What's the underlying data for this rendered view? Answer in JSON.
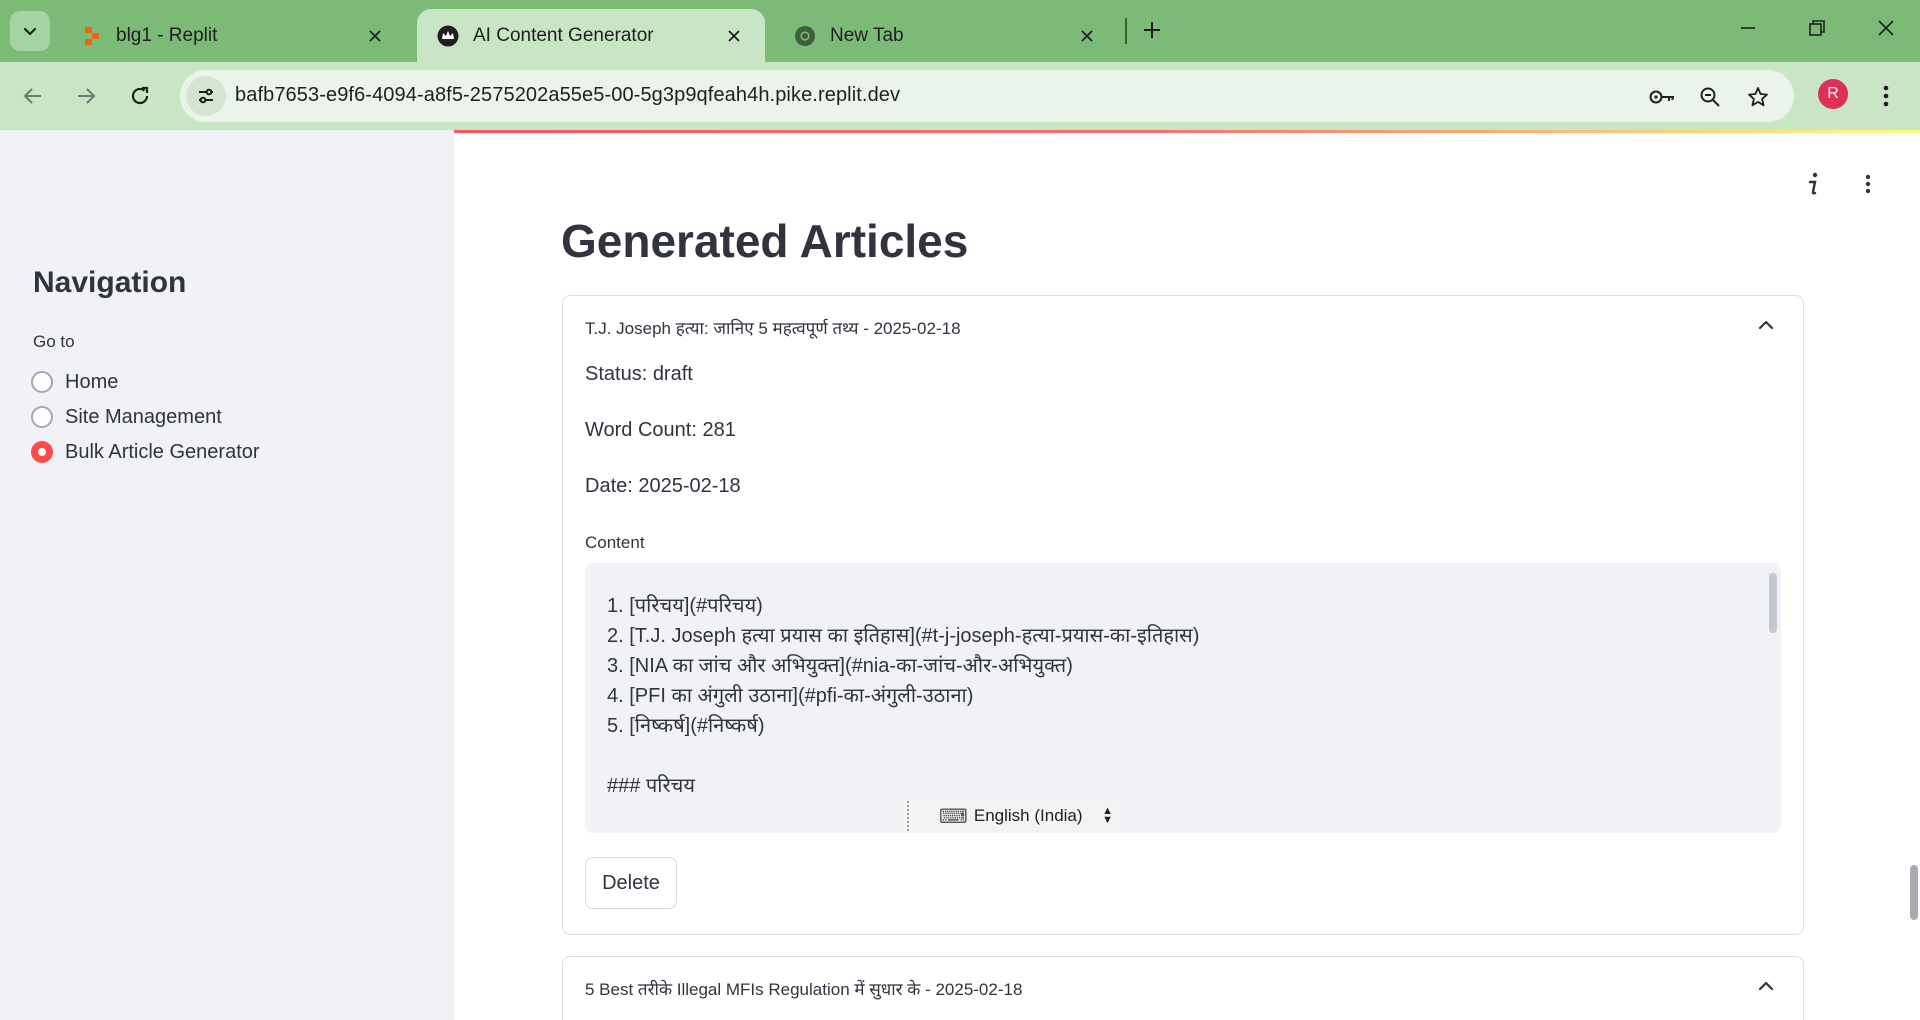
{
  "browser": {
    "tabs": [
      {
        "title": "blg1 - Replit",
        "favicon": "replit-icon",
        "active": false
      },
      {
        "title": "AI Content Generator",
        "favicon": "streamlit-crown-icon",
        "active": true
      },
      {
        "title": "New Tab",
        "favicon": "chrome-icon",
        "active": false
      }
    ],
    "url": "bafb7653-e9f6-4094-a8f5-2575202a55e5-00-5g3p9qfeah4h.pike.replit.dev",
    "profile_initial": "R",
    "accent": "#7cba78"
  },
  "sidebar": {
    "title": "Navigation",
    "goto_label": "Go to",
    "options": [
      {
        "label": "Home",
        "selected": false
      },
      {
        "label": "Site Management",
        "selected": false
      },
      {
        "label": "Bulk Article Generator",
        "selected": true
      }
    ]
  },
  "main": {
    "heading": "Generated Articles",
    "articles": [
      {
        "header": "T.J. Joseph हत्या: जानिए 5 महत्वपूर्ण तथ्य - 2025-02-18",
        "status": "Status: draft",
        "word_count": "Word Count: 281",
        "date": "Date: 2025-02-18",
        "content_label": "Content",
        "content": "1. [परिचय](#परिचय)\n2. [T.J. Joseph हत्या प्रयास का इतिहास](#t-j-joseph-हत्या-प्रयास-का-इतिहास)\n3. [NIA का जांच और अभियुक्त](#nia-का-जांच-और-अभियुक्त)\n4. [PFI का अंगुली उठाना](#pfi-का-अंगुली-उठाना)\n5. [निष्कर्ष](#निष्कर्ष)\n\n### परिचय",
        "delete_label": "Delete"
      },
      {
        "header": "5 Best तरीके Illegal MFIs Regulation में सुधार के - 2025-02-18"
      }
    ]
  },
  "ime": {
    "language": "English (India)"
  }
}
